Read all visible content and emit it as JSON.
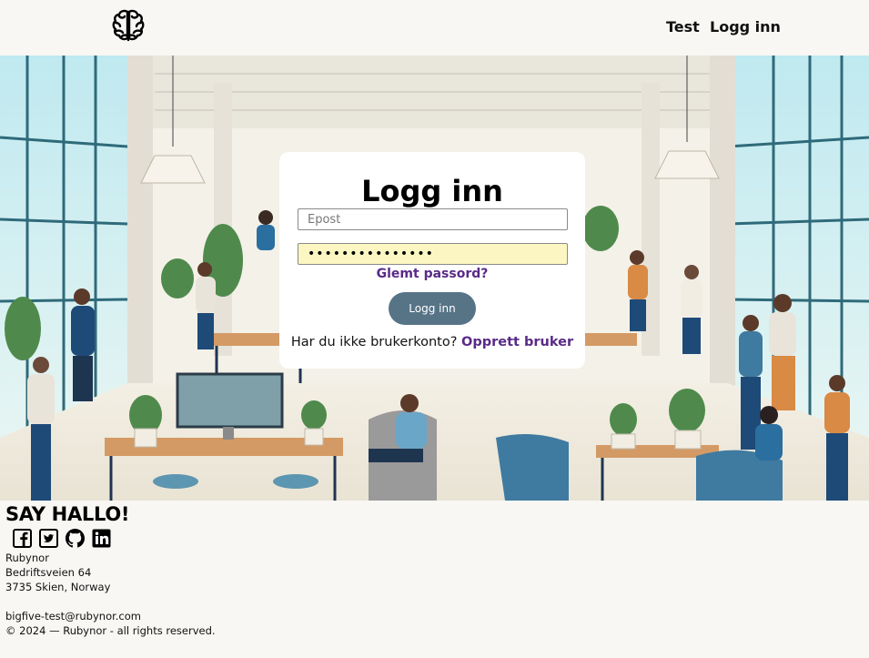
{
  "header": {
    "logo_icon": "brain-icon",
    "nav": {
      "test_label": "Test",
      "login_label": "Logg inn"
    }
  },
  "hero": {
    "image": "office-illustration"
  },
  "login": {
    "title": "Logg inn",
    "email_placeholder": "Epost",
    "password_value": "•••••••••••••••",
    "forgot_label": "Glemt passord?",
    "submit_label": "Logg inn",
    "signup_prompt": "Har du ikke brukerkonto?",
    "signup_link": "Opprett bruker"
  },
  "footer": {
    "heading": "SAY HALLO!",
    "social": [
      "facebook-icon",
      "twitter-icon",
      "github-icon",
      "linkedin-icon"
    ],
    "company": "Rubynor",
    "street": "Bedriftsveien 64",
    "city": "3735 Skien, Norway",
    "email": "bigfive-test@rubynor.com",
    "copyright": "© 2024 — Rubynor - all rights reserved."
  },
  "colors": {
    "button": "#577487",
    "link": "#5a2a88",
    "autofill": "#fcf7c2",
    "page_bg": "#f8f7f4"
  }
}
